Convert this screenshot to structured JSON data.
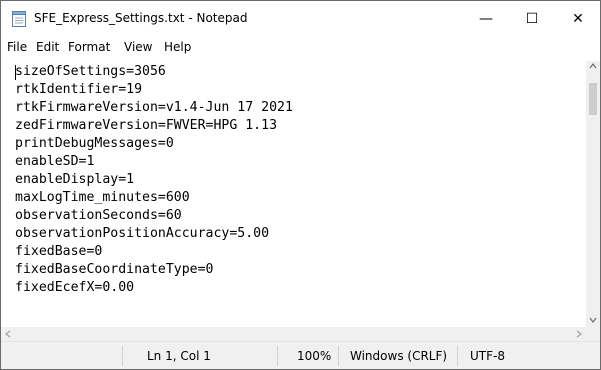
{
  "window": {
    "title": "SFE_Express_Settings.txt - Notepad",
    "controls": {
      "minimize": "—",
      "maximize": "☐",
      "close": "✕"
    }
  },
  "menu": {
    "items": [
      "File",
      "Edit",
      "Format",
      "View",
      "Help"
    ]
  },
  "editor": {
    "lines": [
      "sizeOfSettings=3056",
      "rtkIdentifier=19",
      "rtkFirmwareVersion=v1.4-Jun 17 2021",
      "zedFirmwareVersion=FWVER=HPG 1.13",
      "printDebugMessages=0",
      "enableSD=1",
      "enableDisplay=1",
      "maxLogTime_minutes=600",
      "observationSeconds=60",
      "observationPositionAccuracy=5.00",
      "fixedBase=0",
      "fixedBaseCoordinateType=0",
      "fixedEcefX=0.00"
    ]
  },
  "statusbar": {
    "position": "Ln 1, Col 1",
    "zoom": "100%",
    "line_ending": "Windows (CRLF)",
    "encoding": "UTF-8"
  },
  "icons": {
    "app": "notepad-icon",
    "scroll_up": "scroll-up-arrow-icon",
    "scroll_down": "scroll-down-arrow-icon",
    "scroll_left": "scroll-left-arrow-icon",
    "scroll_right": "scroll-right-arrow-icon"
  },
  "colors": {
    "statusbar_bg": "#f0f0f0",
    "scrollbar_thumb": "#cdcdcd",
    "border": "#6b6b6b"
  }
}
